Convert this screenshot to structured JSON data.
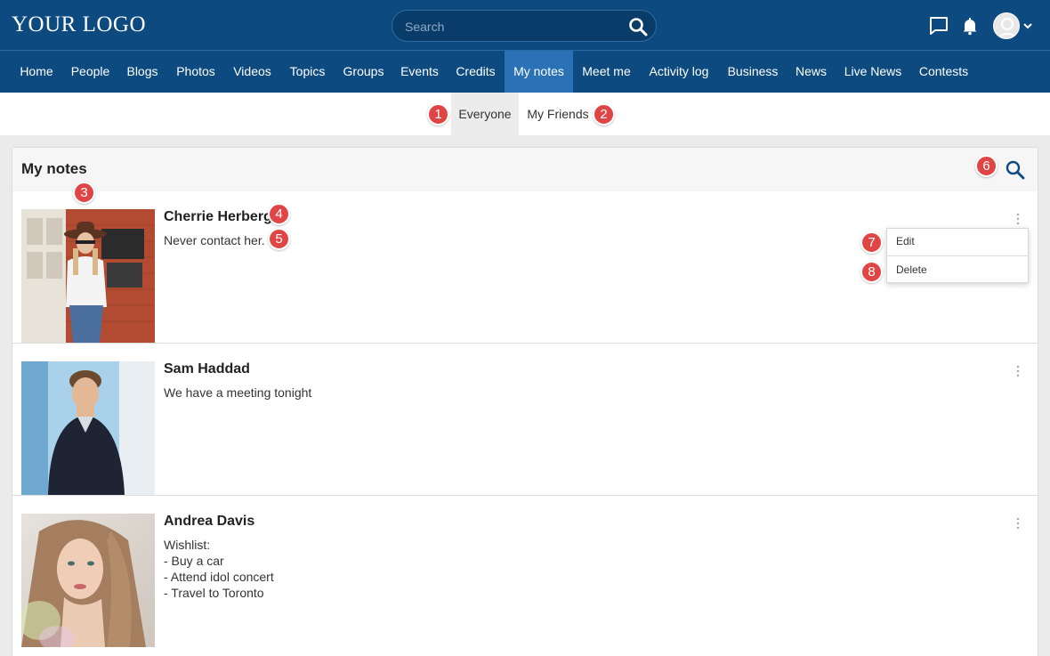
{
  "header": {
    "logo": "YOUR LOGO",
    "search_placeholder": "Search",
    "icons": [
      "search-icon",
      "chat-icon",
      "bell-icon",
      "user-avatar-icon",
      "chevron-down-icon"
    ]
  },
  "nav": {
    "items": [
      {
        "label": "Home"
      },
      {
        "label": "People"
      },
      {
        "label": "Blogs"
      },
      {
        "label": "Photos"
      },
      {
        "label": "Videos"
      },
      {
        "label": "Topics"
      },
      {
        "label": "Groups"
      },
      {
        "label": "Events"
      },
      {
        "label": "Credits"
      },
      {
        "label": "My notes",
        "active": true
      },
      {
        "label": "Meet me"
      },
      {
        "label": "Activity log"
      },
      {
        "label": "Business"
      },
      {
        "label": "News"
      },
      {
        "label": "Live News"
      },
      {
        "label": "Contests"
      }
    ]
  },
  "tabs": {
    "everyone": "Everyone",
    "my_friends": "My Friends",
    "active": "Everyone"
  },
  "page": {
    "title": "My notes"
  },
  "notes": [
    {
      "name": "Cherrie Herberg",
      "lines": [
        "Never contact her."
      ]
    },
    {
      "name": "Sam Haddad",
      "lines": [
        "We have a meeting tonight"
      ]
    },
    {
      "name": "Andrea Davis",
      "lines": [
        "Wishlist:",
        "- Buy a car",
        "- Attend idol concert",
        "- Travel to Toronto"
      ]
    }
  ],
  "menu": {
    "edit": "Edit",
    "delete": "Delete"
  },
  "markers": [
    "1",
    "2",
    "3",
    "4",
    "5",
    "6",
    "7",
    "8"
  ],
  "colors": {
    "header_bg": "#0d4a80",
    "nav_active": "#2a72b5",
    "marker": "#e04545",
    "search_icon": "#0d4a80"
  }
}
